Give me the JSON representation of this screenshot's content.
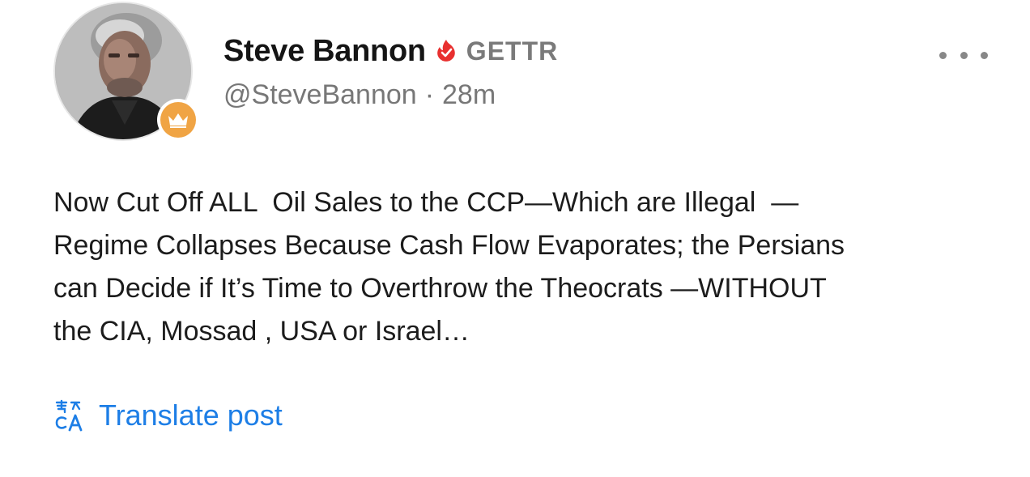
{
  "author": {
    "name": "Steve Bannon",
    "platform": "GETTR",
    "handle": "@SteveBannon",
    "separator": "·",
    "time_ago": "28m",
    "avatar_icon": "profile-photo",
    "badge_icon": "crown-icon",
    "verified_icon": "verified-flame-icon"
  },
  "post": {
    "text": "Now Cut Off ALL  Oil Sales to the CCP—Which are Illegal  —\nRegime Collapses Because Cash Flow Evaporates; the Persians\ncan Decide if It’s Time to Overthrow the Theocrats —WITHOUT\nthe CIA, Mossad , USA or Israel…"
  },
  "actions": {
    "translate_label": "Translate post",
    "translate_icon": "translate-icon",
    "more_icon": "more-options-icon"
  },
  "colors": {
    "accent": "#1d7ee6",
    "verified": "#e8302f",
    "badge": "#f0a444",
    "muted": "#777777"
  }
}
